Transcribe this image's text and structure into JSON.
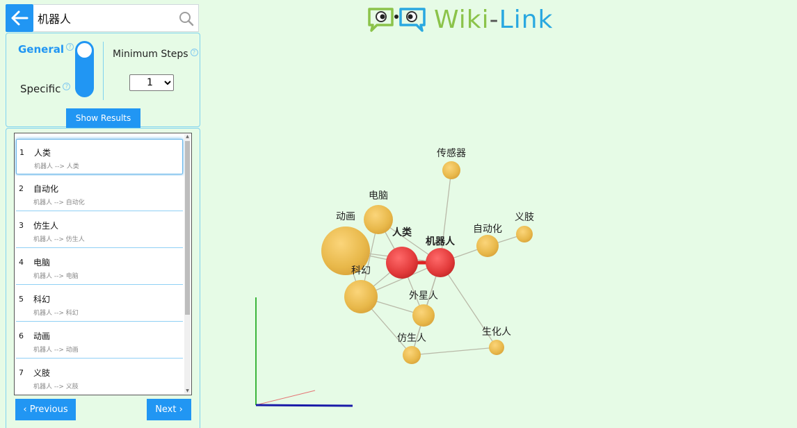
{
  "search": {
    "value": "机器人"
  },
  "settings": {
    "general_label": "General",
    "specific_label": "Specific",
    "help_glyph": "?",
    "steps_label": "Minimum Steps",
    "steps_value": "1",
    "show_results_label": "Show Results"
  },
  "results": [
    {
      "num": "1",
      "title": "人类",
      "path": "机器人 --> 人类"
    },
    {
      "num": "2",
      "title": "自动化",
      "path": "机器人 --> 自动化"
    },
    {
      "num": "3",
      "title": "仿生人",
      "path": "机器人 --> 仿生人"
    },
    {
      "num": "4",
      "title": "电脑",
      "path": "机器人 --> 电脑"
    },
    {
      "num": "5",
      "title": "科幻",
      "path": "机器人 --> 科幻"
    },
    {
      "num": "6",
      "title": "动画",
      "path": "机器人 --> 动画"
    },
    {
      "num": "7",
      "title": "义肢",
      "path": "机器人 --> 义肢"
    }
  ],
  "nav": {
    "previous": "‹ Previous",
    "next": "Next ›"
  },
  "logo": {
    "wiki": "Wiki",
    "dash": "-",
    "link": "Link"
  },
  "graph": {
    "nodes": [
      {
        "id": "传感器",
        "label": "传感器",
        "color": "#e8b84a"
      },
      {
        "id": "电脑",
        "label": "电脑",
        "color": "#e8b84a"
      },
      {
        "id": "动画",
        "label": "动画",
        "color": "#e8b84a"
      },
      {
        "id": "人类",
        "label": "人类",
        "color": "#e23a3a",
        "bold": true
      },
      {
        "id": "机器人",
        "label": "机器人",
        "color": "#e23a3a",
        "bold": true
      },
      {
        "id": "自动化",
        "label": "自动化",
        "color": "#e8b84a"
      },
      {
        "id": "义肢",
        "label": "义肢",
        "color": "#e8b84a"
      },
      {
        "id": "科幻",
        "label": "科幻",
        "color": "#e8b84a"
      },
      {
        "id": "外星人",
        "label": "外星人",
        "color": "#e8b84a"
      },
      {
        "id": "仿生人",
        "label": "仿生人",
        "color": "#e8b84a"
      },
      {
        "id": "生化人",
        "label": "生化人",
        "color": "#e8b84a"
      }
    ],
    "edges": [
      [
        "机器人",
        "传感器"
      ],
      [
        "机器人",
        "人类"
      ],
      [
        "机器人",
        "自动化"
      ],
      [
        "自动化",
        "义肢"
      ],
      [
        "机器人",
        "电脑"
      ],
      [
        "机器人",
        "动画"
      ],
      [
        "机器人",
        "科幻"
      ],
      [
        "机器人",
        "外星人"
      ],
      [
        "机器人",
        "仿生人"
      ],
      [
        "机器人",
        "生化人"
      ],
      [
        "人类",
        "电脑"
      ],
      [
        "人类",
        "科幻"
      ],
      [
        "人类",
        "外星人"
      ],
      [
        "动画",
        "科幻"
      ],
      [
        "电脑",
        "科幻"
      ],
      [
        "科幻",
        "外星人"
      ],
      [
        "科幻",
        "仿生人"
      ],
      [
        "外星人",
        "仿生人"
      ],
      [
        "仿生人",
        "生化人"
      ],
      [
        "动画",
        "人类"
      ]
    ]
  },
  "colors": {
    "accent": "#2196f3",
    "background": "#e6fbe6"
  }
}
